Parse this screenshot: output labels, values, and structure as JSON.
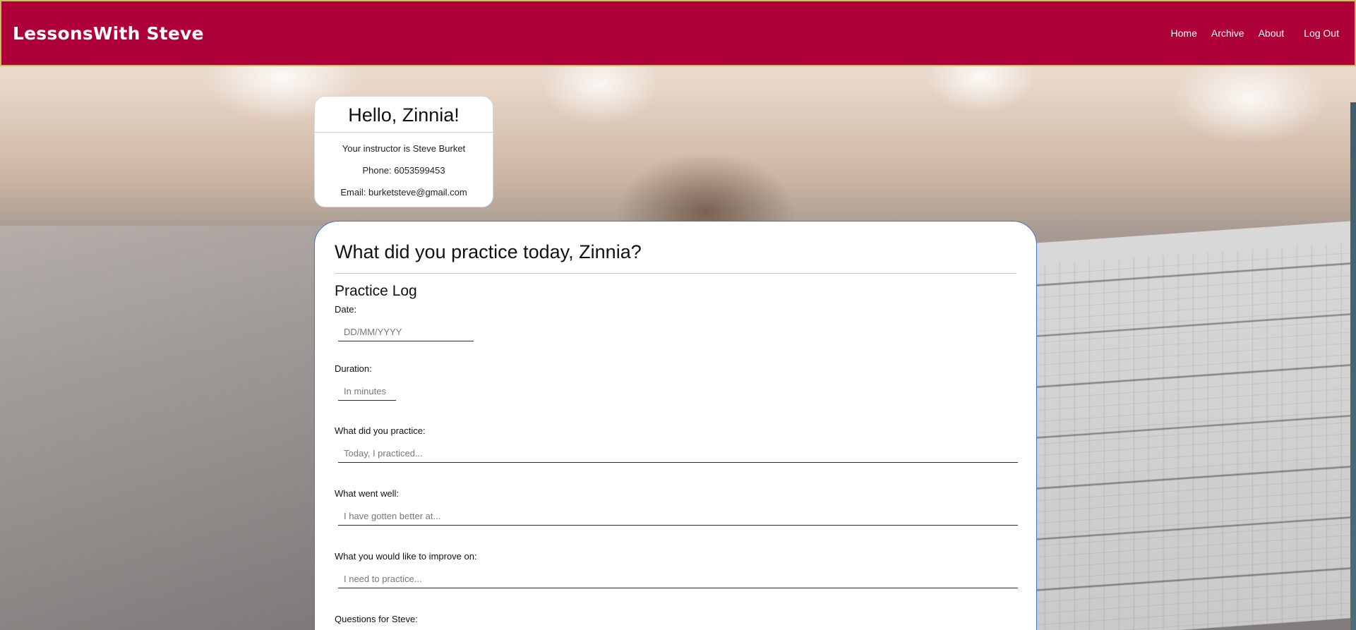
{
  "header": {
    "brand": "LessonsWith Steve",
    "nav": [
      {
        "label": "Home"
      },
      {
        "label": "Archive"
      },
      {
        "label": "About"
      },
      {
        "label": "Log Out"
      }
    ],
    "colors": {
      "background": "#ae0038",
      "border": "#c6bf5a"
    }
  },
  "greeting": {
    "title": "Hello, Zinnia!",
    "instructor": "Your instructor is Steve Burket",
    "phone": "Phone: 6053599453",
    "email": "Email: burketsteve@gmail.com"
  },
  "practice": {
    "heading": "What did you practice today, Zinnia?",
    "section_title": "Practice Log",
    "fields": {
      "date": {
        "label": "Date:",
        "placeholder": "DD/MM/YYYY",
        "value": ""
      },
      "duration": {
        "label": "Duration:",
        "placeholder": "In minutes",
        "value": ""
      },
      "practiced": {
        "label": "What did you practice:",
        "placeholder": "Today, I practiced...",
        "value": ""
      },
      "went_well": {
        "label": "What went well:",
        "placeholder": "I have gotten better at...",
        "value": ""
      },
      "improve": {
        "label": "What you would like to improve on:",
        "placeholder": "I need to practice...",
        "value": ""
      },
      "questions": {
        "label": "Questions for Steve:",
        "value": ""
      }
    },
    "colors": {
      "card_border": "#3d73c9"
    }
  }
}
